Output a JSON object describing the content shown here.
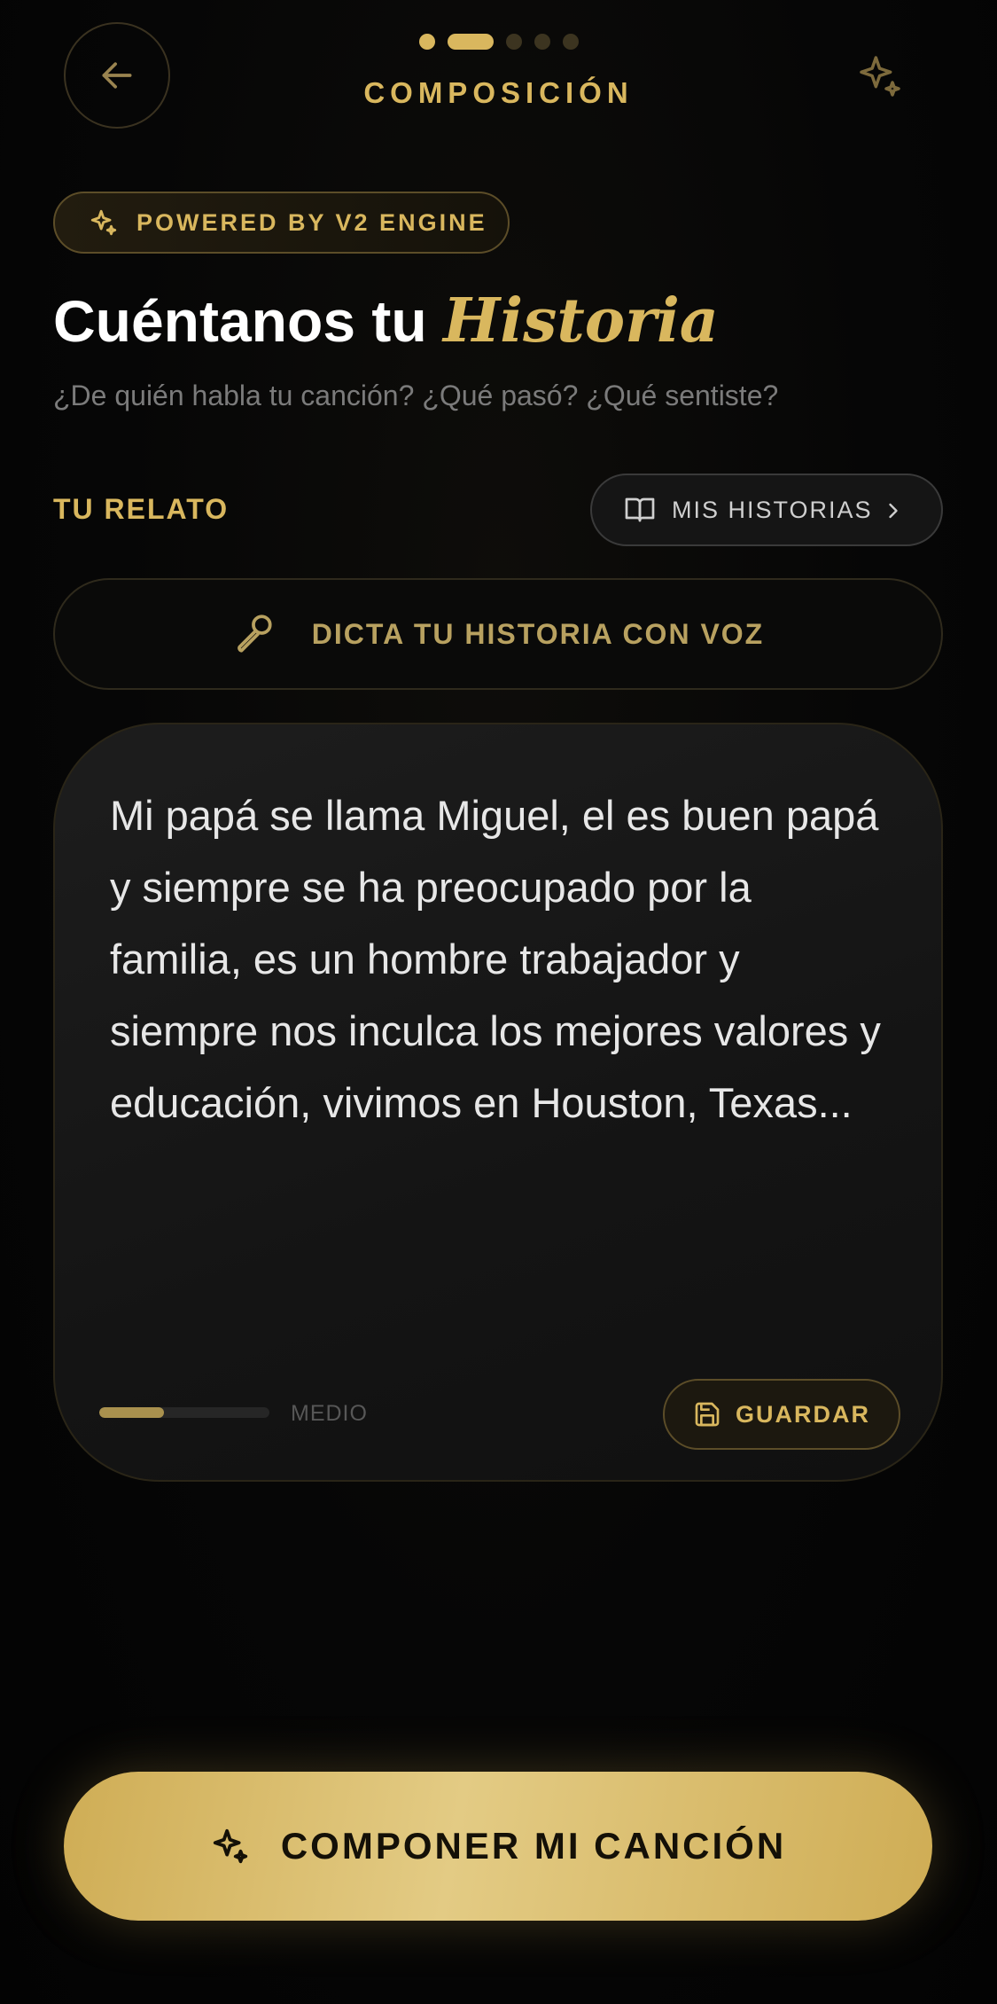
{
  "colors": {
    "accent": "#d9b75e",
    "background": "#050505",
    "card": "#171717"
  },
  "header": {
    "back_icon": "arrow-left-icon",
    "step_title": "COMPOSICIÓN",
    "steps": {
      "total": 5,
      "current": 2
    },
    "sparkle_icon": "sparkles-icon"
  },
  "badge": {
    "icon": "sparkles-icon",
    "label": "POWERED BY V2 ENGINE"
  },
  "hero": {
    "title_main": "Cuéntanos tu",
    "title_accent": "Historia",
    "subtitle": "¿De quién habla tu canción? ¿Qué pasó? ¿Qué sentiste?"
  },
  "section": {
    "label": "TU RELATO",
    "stories_button": {
      "icon": "book-open-icon",
      "label": "MIS HISTORIAS",
      "chevron": "chevron-right-icon"
    }
  },
  "voice_button": {
    "icon": "microphone-icon",
    "label": "DICTA TU HISTORIA CON VOZ"
  },
  "story": {
    "text": "Mi papá se llama Miguel, el es buen papá y siempre se ha preocupado por la familia, es un hombre trabajador y siempre nos inculca los mejores valores y educación, vivimos en Houston, Texas...",
    "length_level": "MEDIO",
    "length_progress": 0.38,
    "save_button": {
      "icon": "save-icon",
      "label": "GUARDAR"
    }
  },
  "cta": {
    "icon": "sparkles-icon",
    "label": "COMPONER MI CANCIÓN"
  }
}
